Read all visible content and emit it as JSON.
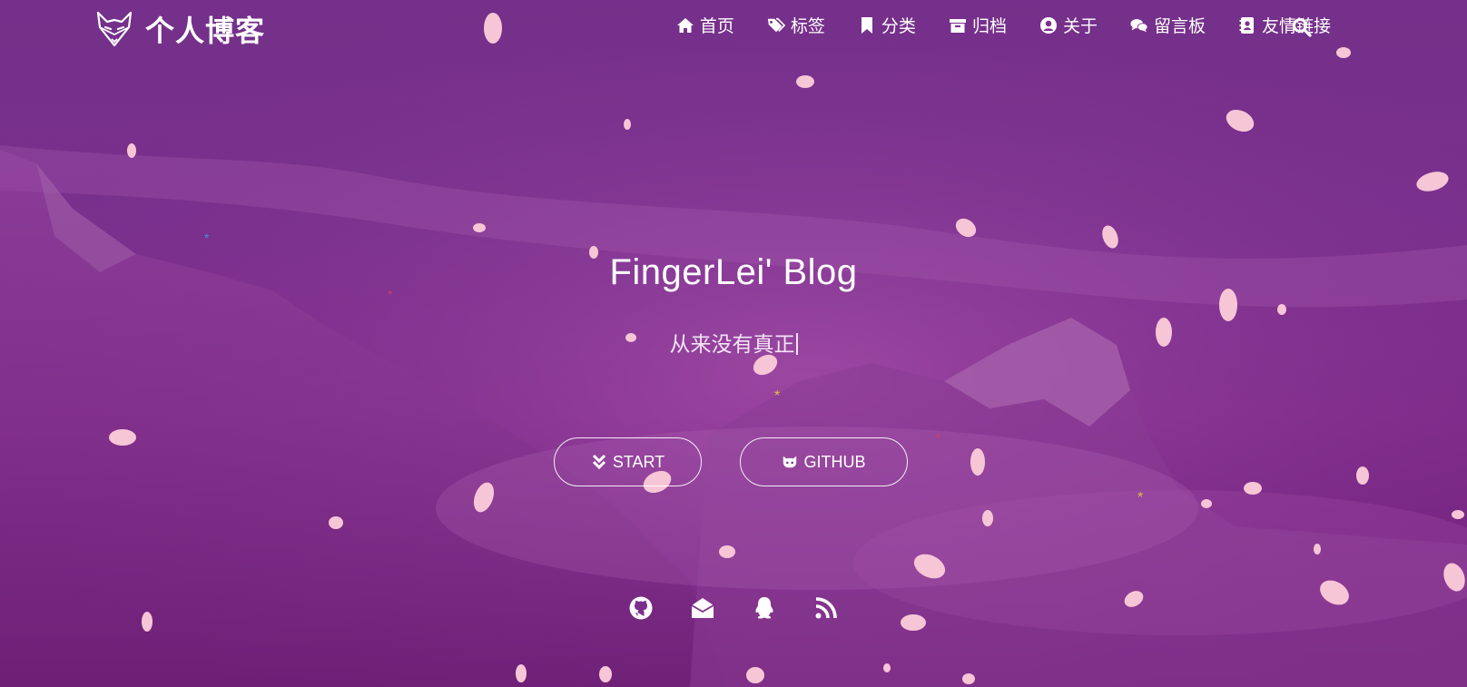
{
  "header": {
    "brand_title": "个人博客",
    "logo_icon": "fox-logo-icon",
    "menu": [
      {
        "label": "首页",
        "icon": "home-icon"
      },
      {
        "label": "标签",
        "icon": "tags-icon"
      },
      {
        "label": "分类",
        "icon": "bookmark-icon"
      },
      {
        "label": "归档",
        "icon": "archive-icon"
      },
      {
        "label": "关于",
        "icon": "user-circle-icon"
      },
      {
        "label": "留言板",
        "icon": "comments-icon"
      },
      {
        "label": "友情链接",
        "icon": "address-book-icon"
      }
    ],
    "search_icon": "search-icon"
  },
  "hero": {
    "title": "FingerLei' Blog",
    "subtitle": "从来没有真正",
    "buttons": [
      {
        "label": "START",
        "icon": "double-chevron-down-icon"
      },
      {
        "label": "GITHUB",
        "icon": "github-alt-icon"
      }
    ]
  },
  "social": [
    {
      "icon": "github-icon"
    },
    {
      "icon": "email-icon"
    },
    {
      "icon": "qq-icon"
    },
    {
      "icon": "rss-icon"
    }
  ],
  "colors": {
    "background": "#7a2f8d",
    "text": "#ffffff",
    "petal": "#f7c6d6"
  }
}
